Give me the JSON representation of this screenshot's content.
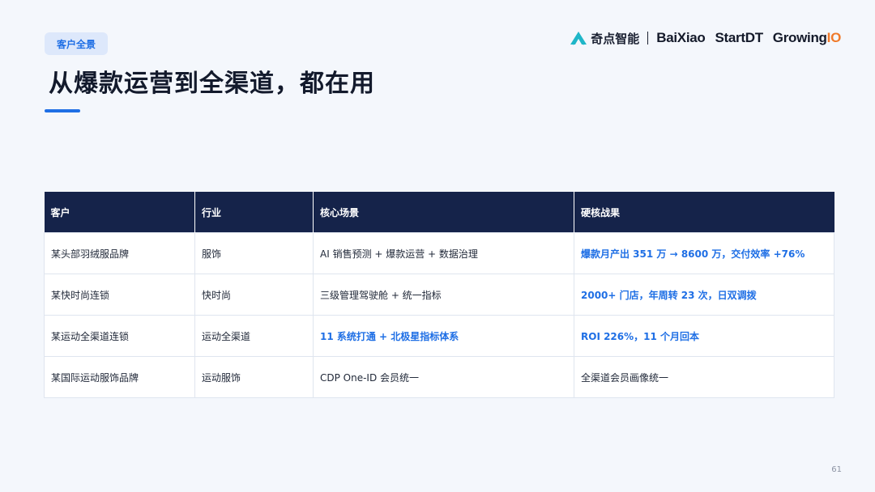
{
  "tag": "客户全景",
  "title": "从爆款运营到全渠道，都在用",
  "logos": {
    "qidian": "奇点智能",
    "baixiao": "BaiXiao",
    "startdt": "StartDT",
    "growingio_main": "Growing",
    "growingio_suffix": "IO",
    "accent_color": "#1fb6c8",
    "io_color": "#f07a2a"
  },
  "table": {
    "headers": [
      "客户",
      "行业",
      "核心场景",
      "硬核战果"
    ],
    "rows": [
      [
        "某头部羽绒服品牌",
        "服饰",
        "AI 销售预测 + 爆款运营 + 数据治理",
        "爆款月产出 351 万 → 8600 万，交付效率 +76%"
      ],
      [
        "某快时尚连锁",
        "快时尚",
        "三级管理驾驶舱 + 统一指标",
        "2000+ 门店，年周转 23 次，日双调拨"
      ],
      [
        "某运动全渠道连锁",
        "运动全渠道",
        "11 系统打通 + 北极星指标体系",
        "ROI 226%，11 个月回本"
      ],
      [
        "某国际运动服饰品牌",
        "运动服饰",
        "CDP One-ID 会员统一",
        "全渠道会员画像统一"
      ]
    ],
    "header_bg": "#15234a",
    "highlight_color": "#1f6fe5"
  },
  "page_number": "61"
}
